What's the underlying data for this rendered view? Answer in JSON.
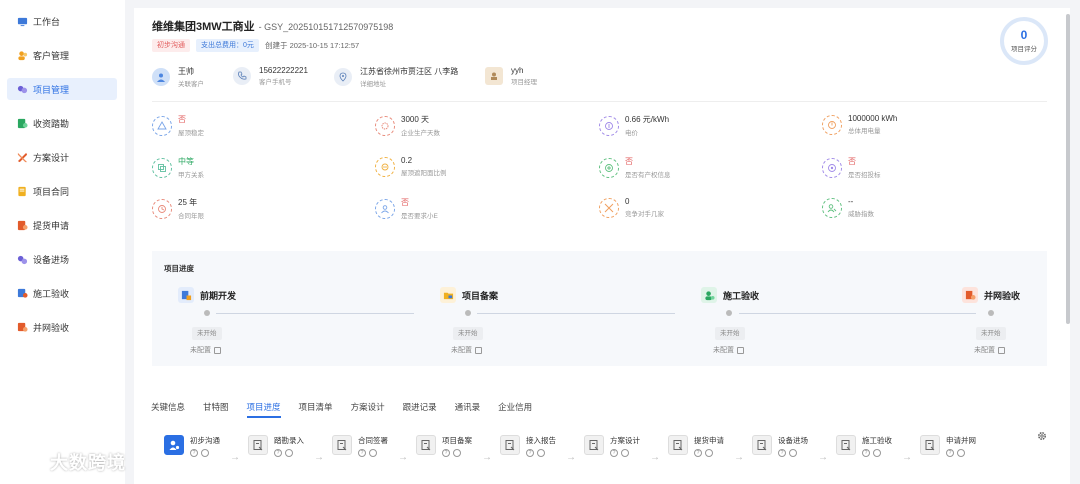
{
  "sidebar": {
    "items": [
      {
        "label": "工作台",
        "icon": "desktop-icon",
        "color": "#3d79d9"
      },
      {
        "label": "客户管理",
        "icon": "users-icon",
        "color": "#f0a020"
      },
      {
        "label": "项目管理",
        "icon": "project-icon",
        "color": "#6b5fd6",
        "active": true
      },
      {
        "label": "收资踏勘",
        "icon": "survey-icon",
        "color": "#2aa760"
      },
      {
        "label": "方案设计",
        "icon": "design-icon",
        "color": "#e25b2b"
      },
      {
        "label": "项目合同",
        "icon": "contract-icon",
        "color": "#f0b020"
      },
      {
        "label": "提货申请",
        "icon": "delivery-icon",
        "color": "#e25b2b"
      },
      {
        "label": "设备进场",
        "icon": "equipment-icon",
        "color": "#6b5fd6"
      },
      {
        "label": "施工验收",
        "icon": "construction-icon",
        "color": "#3d79d9"
      },
      {
        "label": "并网验收",
        "icon": "grid-icon",
        "color": "#e25b2b"
      }
    ]
  },
  "project": {
    "name": "维维集团3MW工商业",
    "code": "- GSY_20251015171257097519 8",
    "code_text": "- GSY_202510151712570975198",
    "tag_stage": "初步沟通",
    "tag_cost": "支出总费用：0元",
    "created": "创建于 2025-10-15 17:12:57"
  },
  "score": {
    "value": "0",
    "label": "项目评分"
  },
  "contacts": [
    {
      "value": "王帅",
      "key": "关联客户",
      "icon": "user-icon"
    },
    {
      "value": "15622222221",
      "key": "客户手机号",
      "icon": "phone-icon"
    },
    {
      "value": "江苏省徐州市贾汪区 八李路",
      "key": "详细地址",
      "icon": "location-icon"
    },
    {
      "value": "yyh",
      "key": "项目经理",
      "icon": "manager-icon"
    }
  ],
  "stats": [
    {
      "value": "否",
      "key": "屋顶稳定",
      "color": "#e15b5b",
      "icon": "triangle-icon",
      "border": "#7aa5e8"
    },
    {
      "value": "3000 天",
      "key": "企业生产天数",
      "color": "#333",
      "icon": "gear-icon",
      "border": "#e88a7a"
    },
    {
      "value": "0.66 元/kWh",
      "key": "电价",
      "color": "#333",
      "icon": "price-icon",
      "border": "#a08ae8"
    },
    {
      "value": "1000000 kWh",
      "key": "总体用电量",
      "color": "#333",
      "icon": "power-icon",
      "border": "#f0a060"
    },
    {
      "value": "中等",
      "key": "甲方关系",
      "color": "#2aa760",
      "icon": "relation-icon",
      "border": "#60c0a0"
    },
    {
      "value": "0.2",
      "key": "屋顶遮阳面比例",
      "color": "#333",
      "icon": "shade-icon",
      "border": "#f0b040"
    },
    {
      "value": "否",
      "key": "是否有产权信息",
      "color": "#e15b5b",
      "icon": "property-icon",
      "border": "#60c080"
    },
    {
      "value": "否",
      "key": "是否招投标",
      "color": "#e15b5b",
      "icon": "bid-icon",
      "border": "#a08ae8"
    },
    {
      "value": "25 年",
      "key": "合同年限",
      "color": "#333",
      "icon": "contract-years-icon",
      "border": "#e88a7a"
    },
    {
      "value": "否",
      "key": "是否要求小E",
      "color": "#e15b5b",
      "icon": "person-icon",
      "border": "#7aa5e8"
    },
    {
      "value": "0",
      "key": "竞争对手几家",
      "color": "#333",
      "icon": "competitor-icon",
      "border": "#f0a060"
    },
    {
      "value": "--",
      "key": "威胁指数",
      "color": "#333",
      "icon": "threat-icon",
      "border": "#60c080"
    }
  ],
  "progress": {
    "title": "项目进度",
    "stages": [
      {
        "label": "前期开发",
        "status": "未开始",
        "config": "未配置",
        "icon_color": "#3d79d9"
      },
      {
        "label": "项目备案",
        "status": "未开始",
        "config": "未配置",
        "icon_color": "#f0b020"
      },
      {
        "label": "施工验收",
        "status": "未开始",
        "config": "未配置",
        "icon_color": "#2aa760"
      },
      {
        "label": "并网验收",
        "status": "未开始",
        "config": "未配置",
        "icon_color": "#e25b2b"
      }
    ]
  },
  "tabs": [
    "关键信息",
    "甘特图",
    "项目进度",
    "项目清单",
    "方案设计",
    "跟进记录",
    "通讯录",
    "企业信用"
  ],
  "active_tab": "项目进度",
  "flow": [
    "初步沟通",
    "踏勘录入",
    "合同签署",
    "项目备案",
    "接入报告",
    "方案设计",
    "提货申请",
    "设备进场",
    "施工验收",
    "申请并网"
  ],
  "watermark": "大数跨境"
}
